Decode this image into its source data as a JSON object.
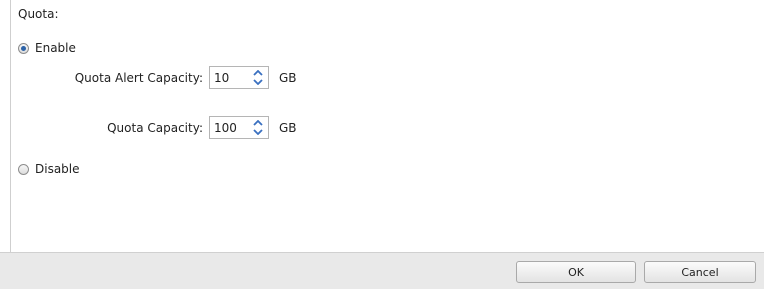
{
  "quota": {
    "section_label": "Quota:",
    "enable_label": "Enable",
    "disable_label": "Disable",
    "selected": "enable",
    "alert_capacity": {
      "label": "Quota Alert Capacity:",
      "value": "10",
      "unit": "GB"
    },
    "capacity": {
      "label": "Quota Capacity:",
      "value": "100",
      "unit": "GB"
    }
  },
  "footer": {
    "ok_label": "OK",
    "cancel_label": "Cancel"
  },
  "icons": {
    "spinner_up": "chevron-up-icon",
    "spinner_down": "chevron-down-icon"
  },
  "colors": {
    "accent": "#2d63a8",
    "footer_bg": "#e9e9e9"
  }
}
